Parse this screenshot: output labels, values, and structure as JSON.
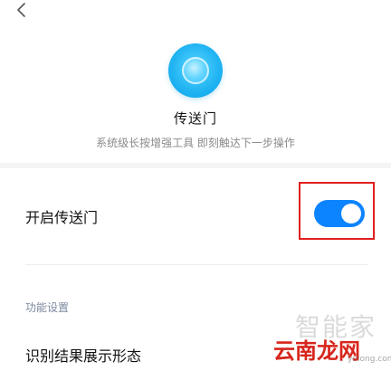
{
  "header": {
    "back_icon": "chevron-left-icon"
  },
  "feature": {
    "icon": "portal-app-icon",
    "title": "传送门",
    "description": "系统级长按增强工具 即刻触达下一步操作"
  },
  "toggle_row": {
    "label": "开启传送门",
    "enabled": true,
    "accent_color": "#0d84ff"
  },
  "section": {
    "header": "功能设置",
    "items": [
      {
        "label": "识别结果展示形态"
      }
    ]
  },
  "watermark": {
    "back": "智能家",
    "front": "云南龙网",
    "small": "ynlong.com"
  }
}
